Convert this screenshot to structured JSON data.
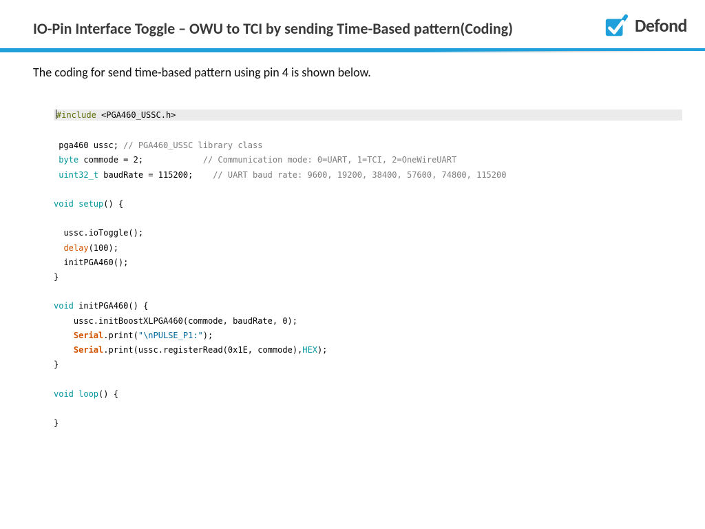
{
  "header": {
    "title": "IO-Pin Interface Toggle – OWU to TCI by sending Time-Based pattern(Coding)",
    "brand": "Defond"
  },
  "intro": "The coding for send time-based pattern using pin 4 is shown below.",
  "code": {
    "include_pp": "#include",
    "include_file": " <PGA460_USSC.h>",
    "decl_class": " pga460 ussc;",
    "decl_class_comment": " // PGA460_USSC library class",
    "byte_kw": " byte",
    "byte_rest": " commode = 2;            ",
    "byte_comment": "// Communication mode: 0=UART, 1=TCI, 2=OneWireUART",
    "uint_kw": " uint32_t",
    "uint_rest": " baudRate = 115200;    ",
    "uint_comment": "// UART baud rate: 9600, 19200, 38400, 57600, 74800, 115200",
    "void_kw": "void",
    "setup_fn": " setup",
    "setup_sig": "() {",
    "io_toggle": "  ussc.ioToggle();",
    "delay_fn": "delay",
    "delay_args": "(100);",
    "init_call": "  initPGA460();",
    "close_brace": "}",
    "init_fn": " initPGA460",
    "init_sig": "() {",
    "init_body": "    ussc.initBoostXLPGA460(commode, baudRate, 0);",
    "serial": "Serial",
    "dot_print": ".print",
    "p1_open": "(",
    "p1_str": "\"\\nPULSE_P1:\"",
    "p1_close": ");",
    "p2_args": "(ussc.registerRead(0x1E, commode),",
    "hex": "HEX",
    "p2_close": ");",
    "loop_fn": " loop",
    "loop_sig": "() {"
  }
}
